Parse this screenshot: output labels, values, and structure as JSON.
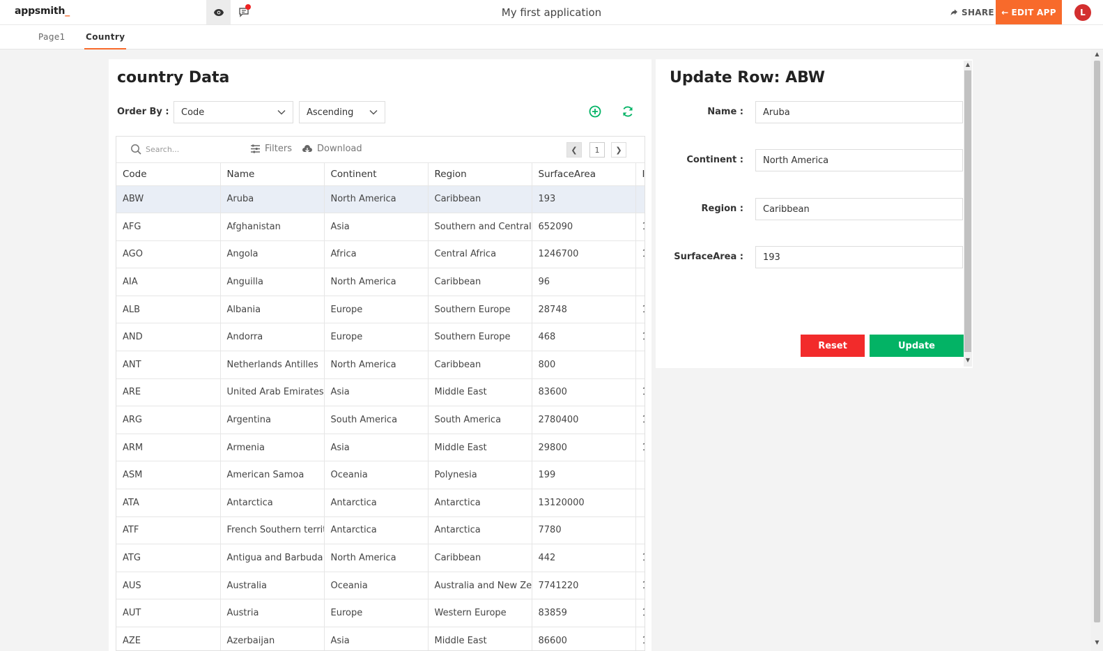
{
  "header": {
    "logo": "appsmith",
    "logo_suffix": "_",
    "app_title": "My first application",
    "share_label": "SHARE",
    "edit_label": "EDIT APP",
    "avatar_initial": "L"
  },
  "pages": [
    {
      "label": "Page1",
      "active": false
    },
    {
      "label": "Country",
      "active": true
    }
  ],
  "table_card": {
    "title": "country Data",
    "order_by_label": "Order By :",
    "order_by_value": "Code",
    "sort_value": "Ascending",
    "search_placeholder": "Search...",
    "filters_label": "Filters",
    "download_label": "Download",
    "page_number": "1",
    "columns": [
      "Code",
      "Name",
      "Continent",
      "Region",
      "SurfaceArea",
      "I"
    ],
    "rows": [
      [
        "ABW",
        "Aruba",
        "North America",
        "Caribbean",
        "193",
        ""
      ],
      [
        "AFG",
        "Afghanistan",
        "Asia",
        "Southern and Central Asia",
        "652090",
        "1"
      ],
      [
        "AGO",
        "Angola",
        "Africa",
        "Central Africa",
        "1246700",
        "1"
      ],
      [
        "AIA",
        "Anguilla",
        "North America",
        "Caribbean",
        "96",
        ""
      ],
      [
        "ALB",
        "Albania",
        "Europe",
        "Southern Europe",
        "28748",
        "1"
      ],
      [
        "AND",
        "Andorra",
        "Europe",
        "Southern Europe",
        "468",
        "1"
      ],
      [
        "ANT",
        "Netherlands Antilles",
        "North America",
        "Caribbean",
        "800",
        ""
      ],
      [
        "ARE",
        "United Arab Emirates",
        "Asia",
        "Middle East",
        "83600",
        "1"
      ],
      [
        "ARG",
        "Argentina",
        "South America",
        "South America",
        "2780400",
        "1"
      ],
      [
        "ARM",
        "Armenia",
        "Asia",
        "Middle East",
        "29800",
        "1"
      ],
      [
        "ASM",
        "American Samoa",
        "Oceania",
        "Polynesia",
        "199",
        ""
      ],
      [
        "ATA",
        "Antarctica",
        "Antarctica",
        "Antarctica",
        "13120000",
        ""
      ],
      [
        "ATF",
        "French Southern territories",
        "Antarctica",
        "Antarctica",
        "7780",
        ""
      ],
      [
        "ATG",
        "Antigua and Barbuda",
        "North America",
        "Caribbean",
        "442",
        "1"
      ],
      [
        "AUS",
        "Australia",
        "Oceania",
        "Australia and New Zealand",
        "7741220",
        "1"
      ],
      [
        "AUT",
        "Austria",
        "Europe",
        "Western Europe",
        "83859",
        "1"
      ],
      [
        "AZE",
        "Azerbaijan",
        "Asia",
        "Middle East",
        "86600",
        "1"
      ]
    ]
  },
  "form": {
    "title": "Update Row: ABW",
    "fields": [
      {
        "label": "Name :",
        "value": "Aruba"
      },
      {
        "label": "Continent :",
        "value": "North America"
      },
      {
        "label": "Region :",
        "value": "Caribbean"
      },
      {
        "label": "SurfaceArea :",
        "value": "193"
      }
    ],
    "reset_label": "Reset",
    "update_label": "Update"
  },
  "colors": {
    "brand": "#f86a2b",
    "reset": "#f22b2b",
    "update": "#03b365",
    "add_icon": "#03b365",
    "selected_row": "#e9eef6"
  }
}
